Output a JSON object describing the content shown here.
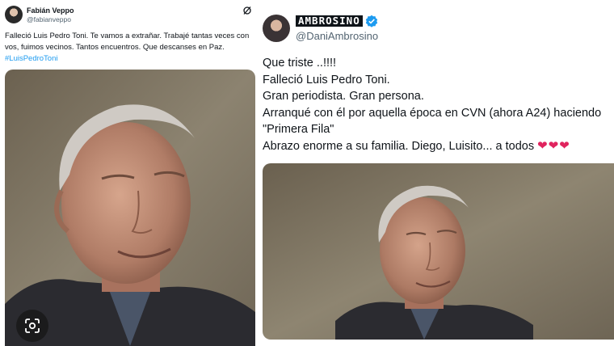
{
  "left_tweet": {
    "author_name": "Fabián Veppo",
    "handle": "@fabianveppo",
    "text": "Falleció Luis Pedro Toni. Te vamos a extrañar. Trabajé tantas veces con vos, fuimos vecinos. Tantos encuentros. Que descanses en Paz.",
    "hashtag": "#LuisPedroToni",
    "grok_icon": "grok-icon",
    "lens_icon": "google-lens-icon"
  },
  "right_tweet": {
    "author_name": "AMBROSINO",
    "verified_icon": "verified-badge-icon",
    "handle": "@DaniAmbrosino",
    "lines": [
      "Que triste ..!!!!",
      "Falleció Luis Pedro Toni.",
      "Gran periodista. Gran persona.",
      "Arranqué con él por aquella época  en CVN (ahora A24) haciendo",
      "\"Primera Fila\"",
      "Abrazo enorme a su familia. Diego, Luisito... a todos"
    ],
    "hearts": "❤❤❤"
  },
  "colors": {
    "link": "#1d9bf0",
    "verified": "#1d9bf0",
    "heart": "#e0245e",
    "handle": "#536471"
  }
}
